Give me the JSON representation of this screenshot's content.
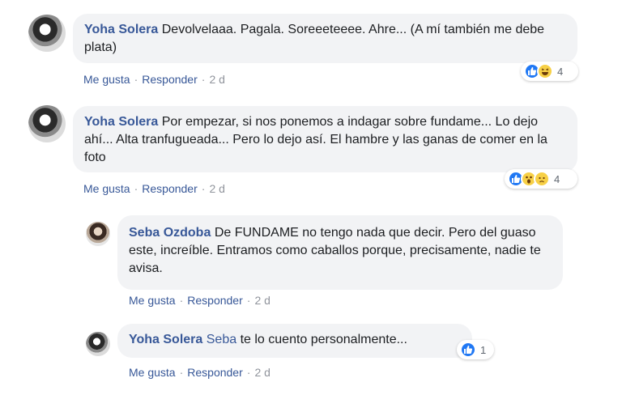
{
  "comments": [
    {
      "author": "Yoha Solera",
      "text": "Devolvelaaa. Pagala. Soreeeteeee. Ahre... (A mí también me debe plata)",
      "reactions": [
        "like",
        "haha"
      ],
      "reaction_count": "4",
      "like_label": "Me gusta",
      "reply_label": "Responder",
      "time": "2 d"
    },
    {
      "author": "Yoha Solera",
      "text": "Por empezar, si nos ponemos a indagar sobre fundame... Lo dejo ahí... Alta tranfugueada... Pero lo dejo así. El hambre y las ganas de comer en la foto",
      "reactions": [
        "like",
        "wow",
        "sad"
      ],
      "reaction_count": "4",
      "like_label": "Me gusta",
      "reply_label": "Responder",
      "time": "2 d"
    }
  ],
  "replies": [
    {
      "author": "Seba Ozdoba",
      "text": "De FUNDAME no tengo nada que decir. Pero del guaso este, increíble. Entramos como caballos porque, precisamente, nadie te avisa.",
      "like_label": "Me gusta",
      "reply_label": "Responder",
      "time": "2 d"
    },
    {
      "author": "Yoha Solera",
      "mention": "Seba",
      "text": "te lo cuento personalmente...",
      "reactions": [
        "like"
      ],
      "reaction_count": "1",
      "like_label": "Me gusta",
      "reply_label": "Responder",
      "time": "2 d"
    }
  ],
  "separator": "·",
  "colors": {
    "author": "#385898",
    "bubble": "#f2f3f5",
    "like": "#2078f4",
    "emoji": "#f7d046"
  }
}
